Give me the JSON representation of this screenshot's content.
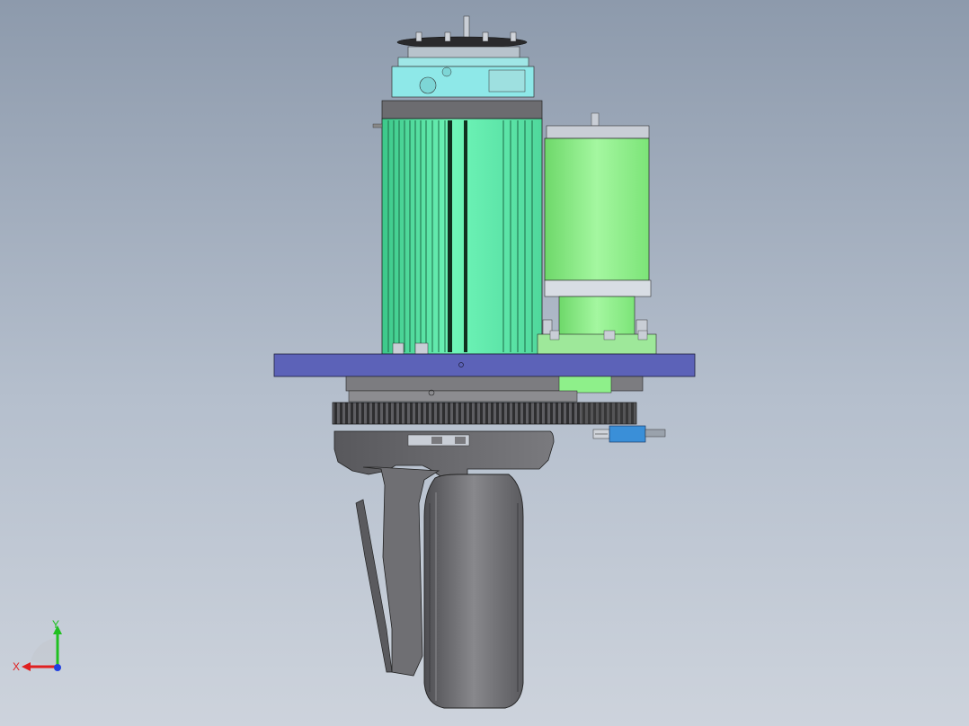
{
  "viewport": {
    "background_top": "#8d9aac",
    "background_bottom": "#cdd3dc"
  },
  "model": {
    "colors": {
      "motor_green": "#6ff5b8",
      "motor_green_dark": "#3cc88a",
      "brake_green": "#8ef08a",
      "cap_cyan": "#8ee8e8",
      "plate_blue": "#5c62b8",
      "casing_gray": "#6f6f73",
      "wheel_gray": "#76767a",
      "sensor_blue": "#3a8fd8"
    }
  },
  "triad": {
    "x_label": "X",
    "y_label": "Y",
    "x_color": "#e02020",
    "y_color": "#20c020",
    "z_color": "#2040e0"
  }
}
